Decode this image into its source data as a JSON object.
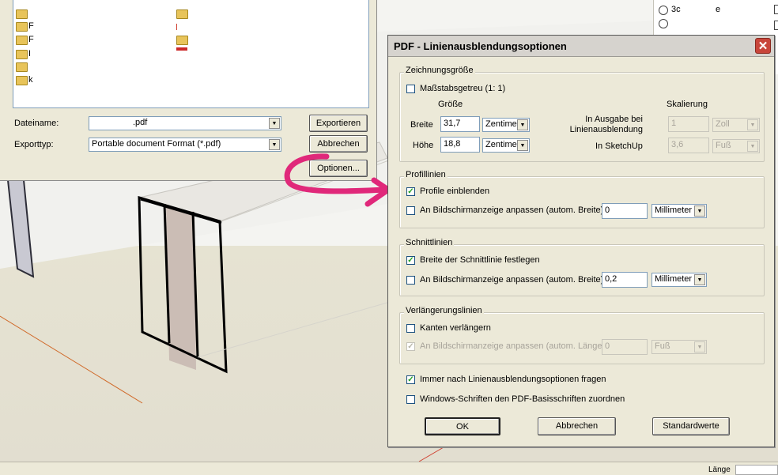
{
  "export_dialog": {
    "filename_label": "Dateiname:",
    "filename_value": ".pdf",
    "filetype_label": "Exporttyp:",
    "filetype_value": "Portable document Format (*.pdf)",
    "export_button": "Exportieren",
    "cancel_button": "Abbrechen",
    "options_button": "Optionen...",
    "files": [
      "F",
      "F",
      "I",
      "k"
    ]
  },
  "right_panel": {
    "item_1": "3c",
    "item_1_suffix": "e"
  },
  "dialog": {
    "title": "PDF - Linienausblendungsoptionen",
    "close_glyph": "✕",
    "drawing_size": {
      "group_title": "Zeichnungsgröße",
      "scale_true_label": "Maßstabsgetreu (1: 1)",
      "scale_true_checked": false,
      "size_header": "Größe",
      "scaling_header": "Skalierung",
      "width_label": "Breite",
      "width_value": "31,7",
      "width_unit": "Zentime",
      "height_label": "Höhe",
      "height_value": "18,8",
      "height_unit": "Zentime",
      "output_label": "In Ausgabe bei Linienausblendung",
      "output_value": "1",
      "output_unit": "Zoll",
      "sketchup_label": "In SketchUp",
      "sketchup_value": "3,6",
      "sketchup_unit": "Fuß"
    },
    "profile_lines": {
      "group_title": "Profillinien",
      "show_label": "Profile einblenden",
      "show_checked": true,
      "match_label": "An Bildschirmanzeige anpassen (autom. Breite)",
      "match_checked": false,
      "width_value": "0",
      "width_unit": "Millimeter"
    },
    "section_lines": {
      "group_title": "Schnittlinien",
      "fixed_label": "Breite der Schnittlinie festlegen",
      "fixed_checked": true,
      "match_label": "An Bildschirmanzeige anpassen (autom. Breite)",
      "match_checked": false,
      "width_value": "0,2",
      "width_unit": "Millimeter"
    },
    "extension_lines": {
      "group_title": "Verlängerungslinien",
      "extend_label": "Kanten verlängern",
      "extend_checked": false,
      "match_label": "An Bildschirmanzeige anpassen (autom. Länge)",
      "match_checked": true,
      "length_value": "0",
      "length_unit": "Fuß"
    },
    "always_ask_label": "Immer nach Linienausblendungsoptionen fragen",
    "always_ask_checked": true,
    "map_fonts_label": "Windows-Schriften den PDF-Basisschriften zuordnen",
    "map_fonts_checked": false,
    "ok_button": "OK",
    "cancel_button": "Abbrechen",
    "defaults_button": "Standardwerte"
  },
  "status": {
    "length_label": "Länge"
  },
  "colors": {
    "annotation_arrow": "#e0287a",
    "close_button": "#c8453a"
  }
}
